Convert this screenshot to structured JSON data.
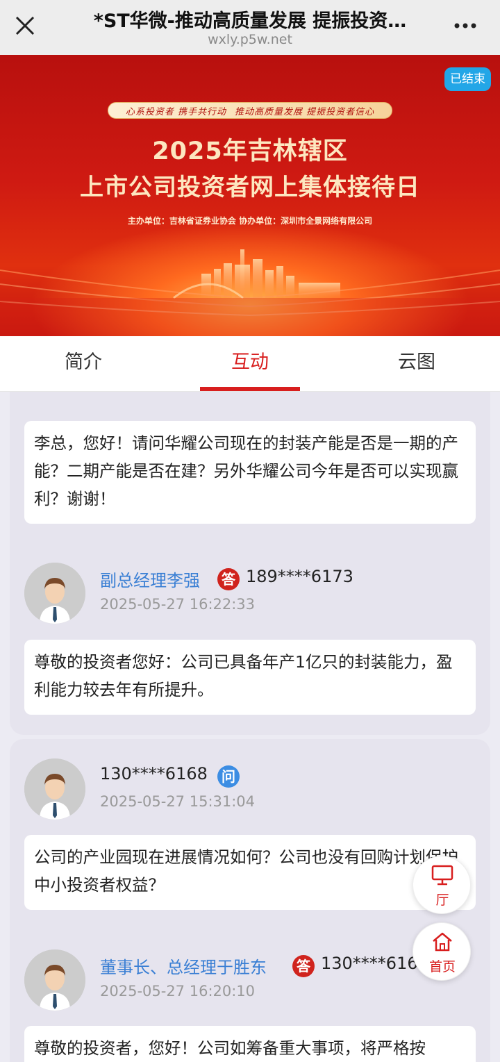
{
  "topbar": {
    "title": "*ST华微-推动高质量发展 提振投资…",
    "url": "wxly.p5w.net"
  },
  "banner": {
    "badge": "已结束",
    "slogan_left": "心系投资者 携手共行动",
    "slogan_right": "推动高质量发展 提振投资者信心",
    "title_line1": "2025年吉林辖区",
    "title_line2": "上市公司投资者网上集体接待日",
    "host": "主办单位：吉林省证券业协会    协办单位：深圳市全景网络有限公司"
  },
  "tabs": [
    {
      "label": "简介"
    },
    {
      "label": "互动"
    },
    {
      "label": "云图"
    }
  ],
  "feed": {
    "card1": {
      "question": "李总，您好！请问华耀公司现在的封装产能是否是一期的产能？二期产能是否在建？另外华耀公司今年是否可以实现赢利？谢谢！",
      "answer_user": "副总经理李强",
      "answer_tag": "答",
      "answer_phone": "189****6173",
      "answer_time": "2025-05-27 16:22:33",
      "answer": "尊敬的投资者您好：公司已具备年产1亿只的封装能力，盈利能力较去年有所提升。"
    },
    "card2": {
      "ask_phone": "130****6168",
      "ask_tag": "问",
      "ask_time": "2025-05-27 15:31:04",
      "question": "公司的产业园现在进展情况如何？公司也没有回购计划保护中小投资者权益？",
      "answer_user": "董事长、总经理于胜东",
      "answer_tag": "答",
      "answer_phone": "130****6168",
      "answer_time": "2025-05-27 16:20:10",
      "answer": "尊敬的投资者，您好！公司如筹备重大事项，将严格按"
    }
  },
  "fabs": {
    "hall": "厅",
    "home": "首页"
  },
  "colors": {
    "accent": "#d81e1e",
    "link_blue": "#3a7fd4",
    "badge_blue": "#23a6e7"
  }
}
